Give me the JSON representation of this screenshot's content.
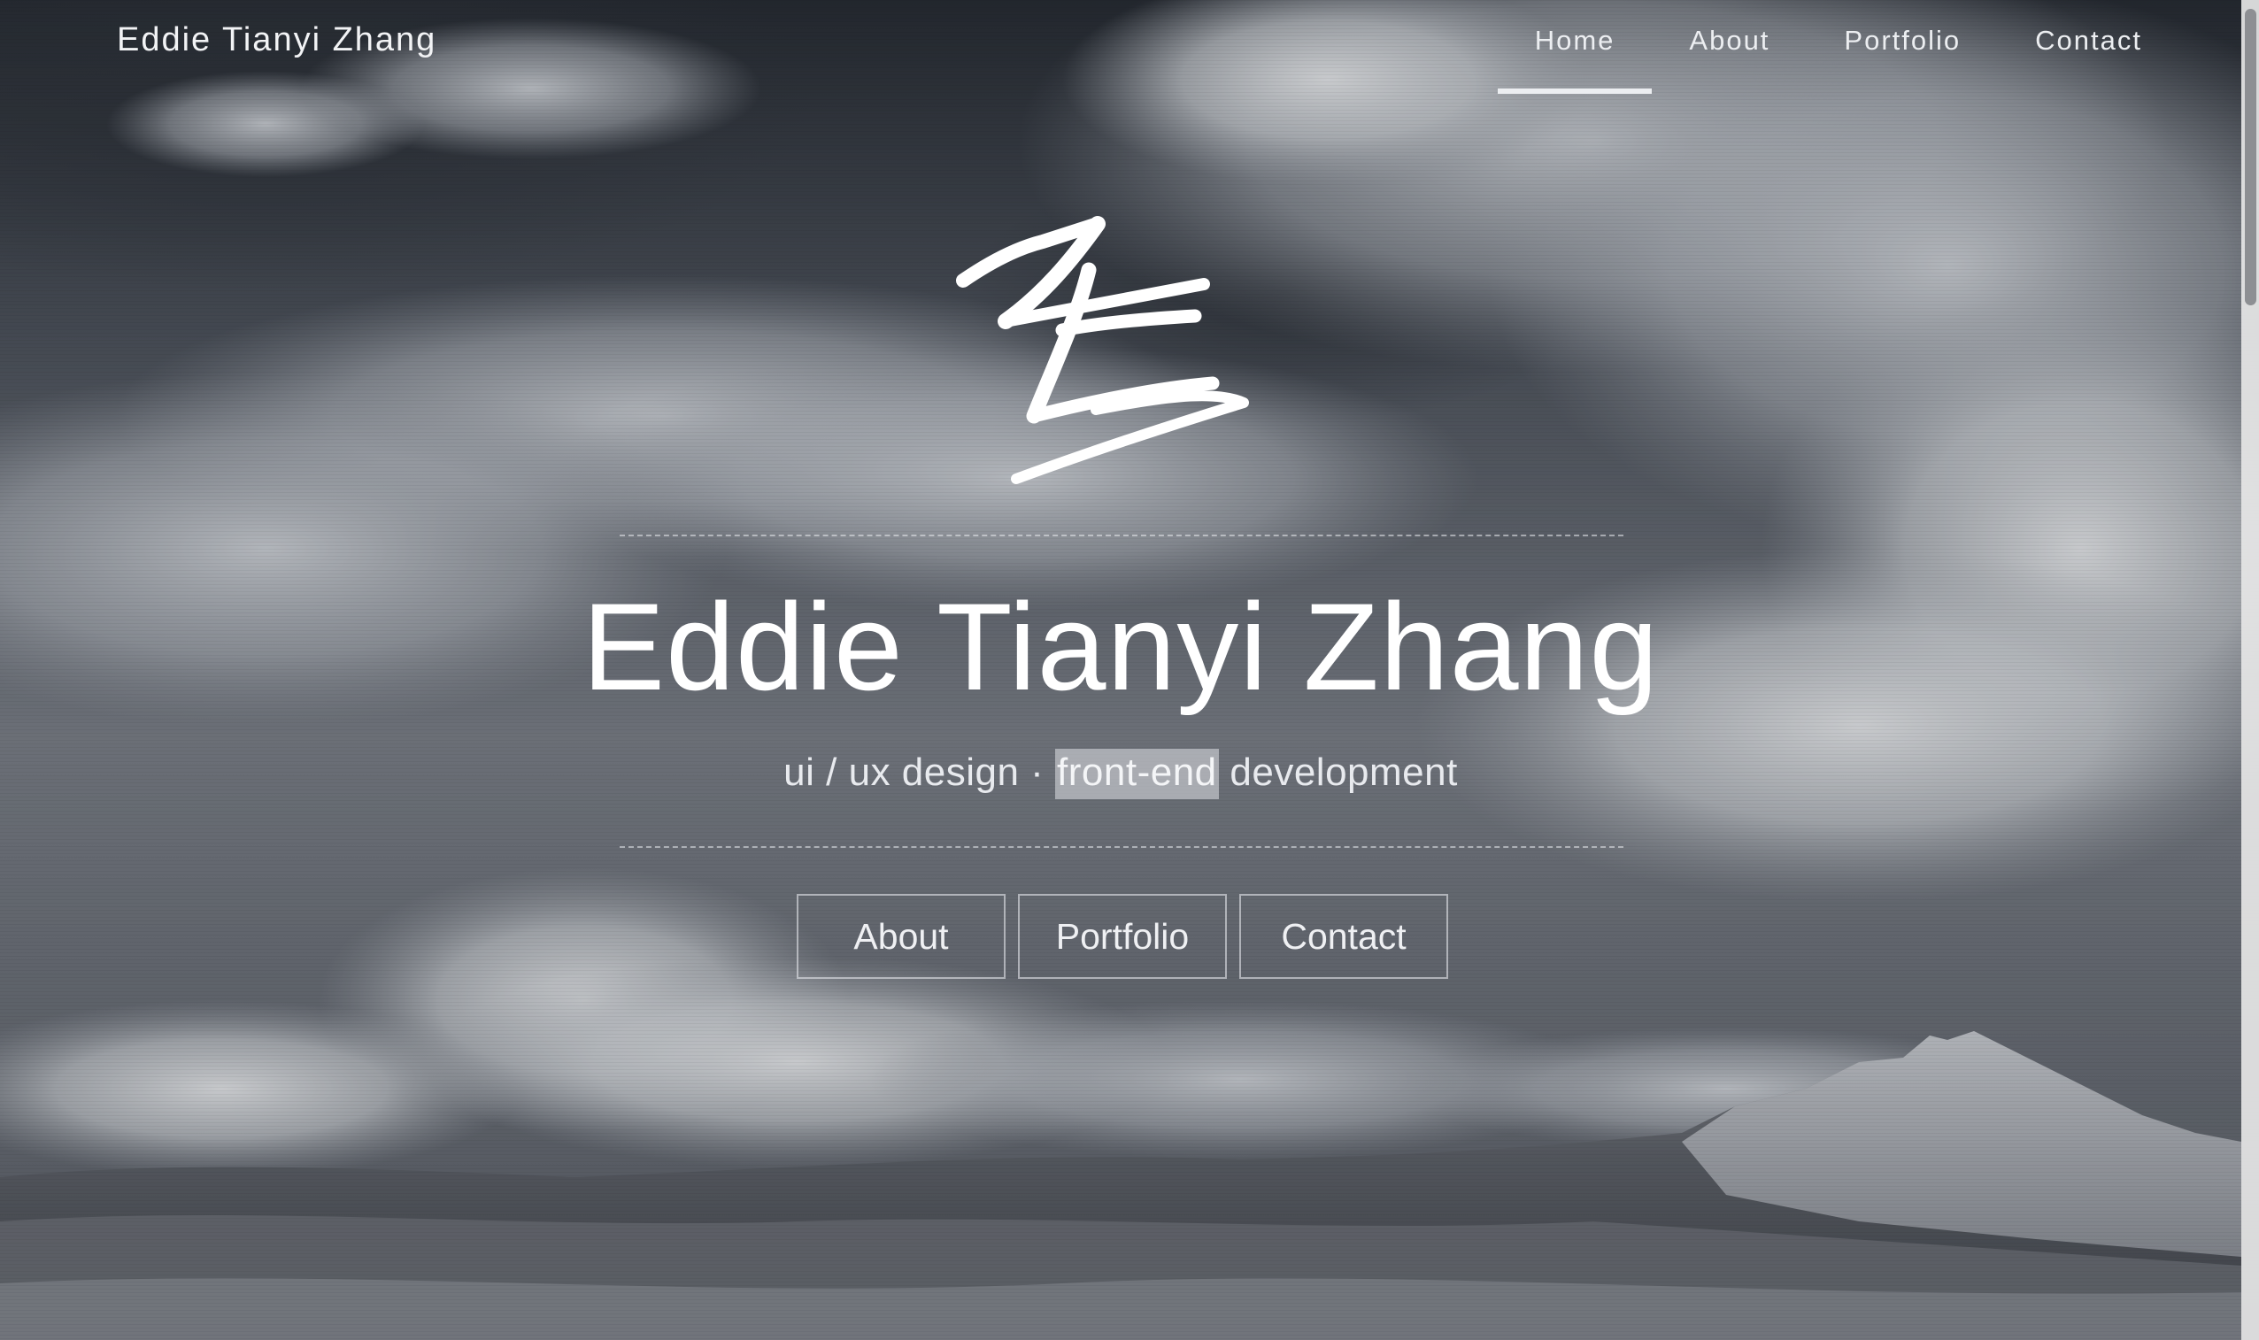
{
  "header": {
    "brand": "Eddie Tianyi Zhang",
    "nav": [
      {
        "label": "Home",
        "active": true
      },
      {
        "label": "About",
        "active": false
      },
      {
        "label": "Portfolio",
        "active": false
      },
      {
        "label": "Contact",
        "active": false
      }
    ]
  },
  "hero": {
    "logo_icon": "ze-monogram-icon",
    "title": "Eddie Tianyi Zhang",
    "subtitle_before": "ui / ux design · ",
    "subtitle_highlight": "front-end",
    "subtitle_after": " development",
    "buttons": [
      {
        "label": "About"
      },
      {
        "label": "Portfolio"
      },
      {
        "label": "Contact"
      }
    ]
  },
  "colors": {
    "text_primary": "#ffffff",
    "highlight_bg": "#d2d4d8",
    "sky_dark": "#23262c",
    "sky_light": "#b8bcc3"
  }
}
